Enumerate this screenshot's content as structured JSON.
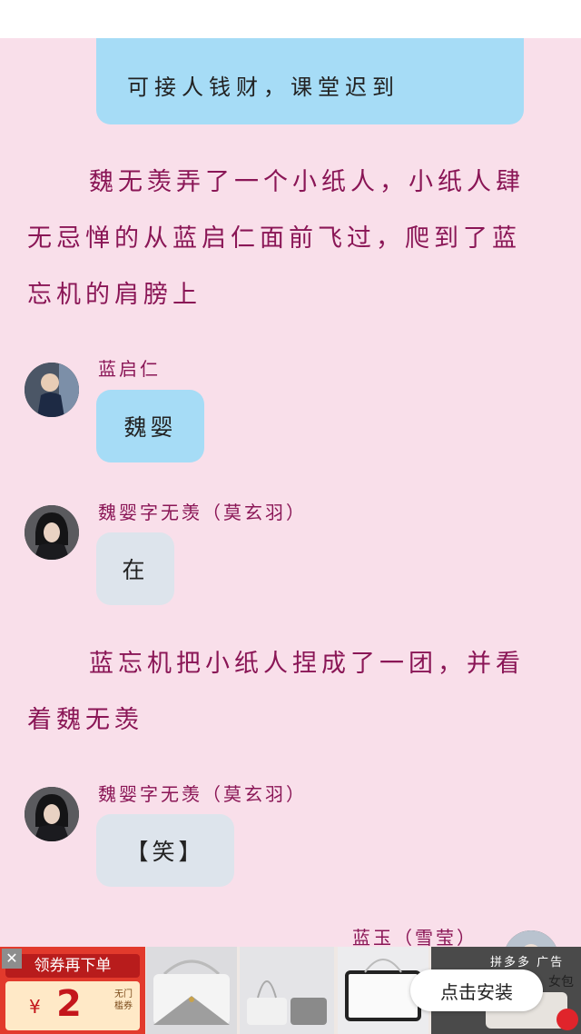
{
  "top_bubble": {
    "text": "可接人钱财，课堂迟到"
  },
  "narrations": [
    "魏无羡弄了一个小纸人，小纸人肆无忌惮的从蓝启仁面前飞过，爬到了蓝忘机的肩膀上",
    "蓝忘机把小纸人捏成了一团，并看着魏无羡"
  ],
  "messages": [
    {
      "sender": "蓝启仁",
      "text": "魏婴"
    },
    {
      "sender": "魏婴字无羡（莫玄羽）",
      "text": "在"
    },
    {
      "sender": "魏婴字无羡（莫玄羽）",
      "text": "【笑】"
    }
  ],
  "partial_message": {
    "sender": "蓝玉（雪莹）"
  },
  "ad": {
    "close_icon": "close-icon",
    "coupon_title": "领券再下单",
    "coupon_currency": "¥",
    "coupon_amount": "2",
    "coupon_note": "无门槛券",
    "install_label": "点击安装",
    "tag": "拼多多 广告",
    "partial_text": "女包"
  },
  "colors": {
    "background": "#f9dfea",
    "narration_text": "#8a1656",
    "bubble_blue": "#a6dcf6",
    "bubble_gray": "#dde4ec",
    "coupon_red": "#e23a2c"
  }
}
